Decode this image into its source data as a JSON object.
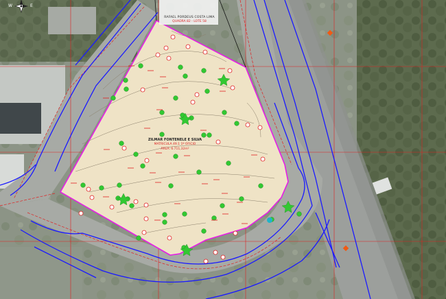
{
  "compass": {
    "west": "W",
    "east": "E"
  },
  "neighbor": {
    "name": "RAFAEL PORDEUS COSTA LIMA",
    "record": "QUADRA 82 - LOTE 58"
  },
  "parcel": {
    "owner": "ZILMAR FONTENELE E SILVA",
    "registry": "MATRICULA 49.1 1º OFICIO",
    "area": "ÁREA: 6.711,32m²"
  },
  "colors": {
    "boundary": "#e61ee6",
    "road_lines": "#1a1aff",
    "grid": "#e02020",
    "parcel_fill": "#efe3c6",
    "trees": "#32c832",
    "markers": "#e02020"
  },
  "icons": [
    "compass-rose-icon",
    "tree-icon",
    "survey-point-icon",
    "reference-marker-icon"
  ]
}
